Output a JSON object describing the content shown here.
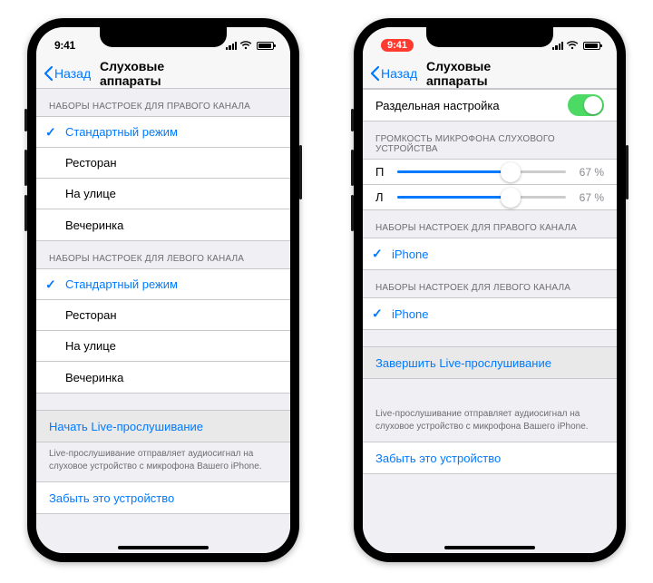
{
  "phone1": {
    "status": {
      "time": "9:41"
    },
    "nav": {
      "back": "Назад",
      "title": "Слуховые аппараты"
    },
    "right_section_header": "НАБОРЫ НАСТРОЕК ДЛЯ ПРАВОГО КАНАЛА",
    "right_presets": [
      {
        "label": "Стандартный режим",
        "selected": true
      },
      {
        "label": "Ресторан",
        "selected": false
      },
      {
        "label": "На улице",
        "selected": false
      },
      {
        "label": "Вечеринка",
        "selected": false
      }
    ],
    "left_section_header": "НАБОРЫ НАСТРОЕК ДЛЯ ЛЕВОГО КАНАЛА",
    "left_presets": [
      {
        "label": "Стандартный режим",
        "selected": true
      },
      {
        "label": "Ресторан",
        "selected": false
      },
      {
        "label": "На улице",
        "selected": false
      },
      {
        "label": "Вечеринка",
        "selected": false
      }
    ],
    "live_listen_start": "Начать Live-прослушивание",
    "live_listen_footer": "Live-прослушивание отправляет аудиосигнал на слуховое устройство с микрофона Вашего iPhone.",
    "forget_device": "Забыть это устройство"
  },
  "phone2": {
    "status": {
      "time": "9:41"
    },
    "nav": {
      "back": "Назад",
      "title": "Слуховые аппараты"
    },
    "separate_adjust": {
      "label": "Раздельная настройка",
      "on": true
    },
    "mic_volume_header": "ГРОМКОСТЬ МИКРОФОНА СЛУХОВОГО УСТРОЙСТВА",
    "sliders": [
      {
        "label": "П",
        "value_text": "67 %",
        "percent": 67
      },
      {
        "label": "Л",
        "value_text": "67 %",
        "percent": 67
      }
    ],
    "right_section_header": "НАБОРЫ НАСТРОЕК ДЛЯ ПРАВОГО КАНАЛА",
    "right_preset": {
      "label": "iPhone",
      "selected": true
    },
    "left_section_header": "НАБОРЫ НАСТРОЕК ДЛЯ ЛЕВОГО КАНАЛА",
    "left_preset": {
      "label": "iPhone",
      "selected": true
    },
    "live_listen_stop": "Завершить Live-прослушивание",
    "live_listen_footer": "Live-прослушивание отправляет аудиосигнал на слуховое устройство с микрофона Вашего iPhone.",
    "forget_device": "Забыть это устройство"
  }
}
